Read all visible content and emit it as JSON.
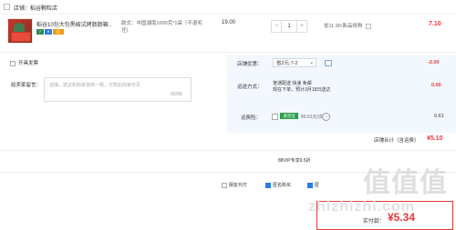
{
  "store": {
    "label": "店铺：稻谷颗粒店"
  },
  "item": {
    "title": "稻谷10包大包黑椒试烤肠肠箱...",
    "spec": "款式：中国湖南1000克*1袋（不退毛坯）",
    "unit_price": "19.00",
    "quantity": "1",
    "qty_minus": "−",
    "qty_plus": "+",
    "promo": "省11.90:新品抢购",
    "subtotal": "7.10",
    "badges": [
      "7",
      "¥",
      "返"
    ]
  },
  "invoice": {
    "label": "开具发票"
  },
  "message": {
    "label": "给卖家留言：",
    "placeholder": "选填，建议和商家协商一致，付款后商家可见",
    "count": "0/200"
  },
  "coupon": {
    "label": "店铺优惠：",
    "value": "省2元:7-2",
    "amount": "-2.00"
  },
  "shipping": {
    "label": "运送方式：",
    "line1": "普通配送 快递 免邮",
    "line2": "现在下单，预计3月18日送达",
    "amount": "0.00"
  },
  "insurance": {
    "label": "运费险：",
    "badge": "退货宝",
    "price": "¥0.61元/次",
    "amount": "0.61"
  },
  "store_total": {
    "label": "店铺合计（含运费）",
    "value": "¥5.10"
  },
  "vip": {
    "text": "88VIP专享9.5折"
  },
  "footer": {
    "options": [
      {
        "label": "朋友代付",
        "checked": false
      },
      {
        "label": "匿名购买",
        "checked": true
      },
      {
        "label": "匿",
        "checked": true
      }
    ]
  },
  "pay": {
    "label": "实付款：",
    "value": "¥5.34"
  },
  "watermark": {
    "big": "值值值",
    "url": "zhizhizhi.com"
  }
}
